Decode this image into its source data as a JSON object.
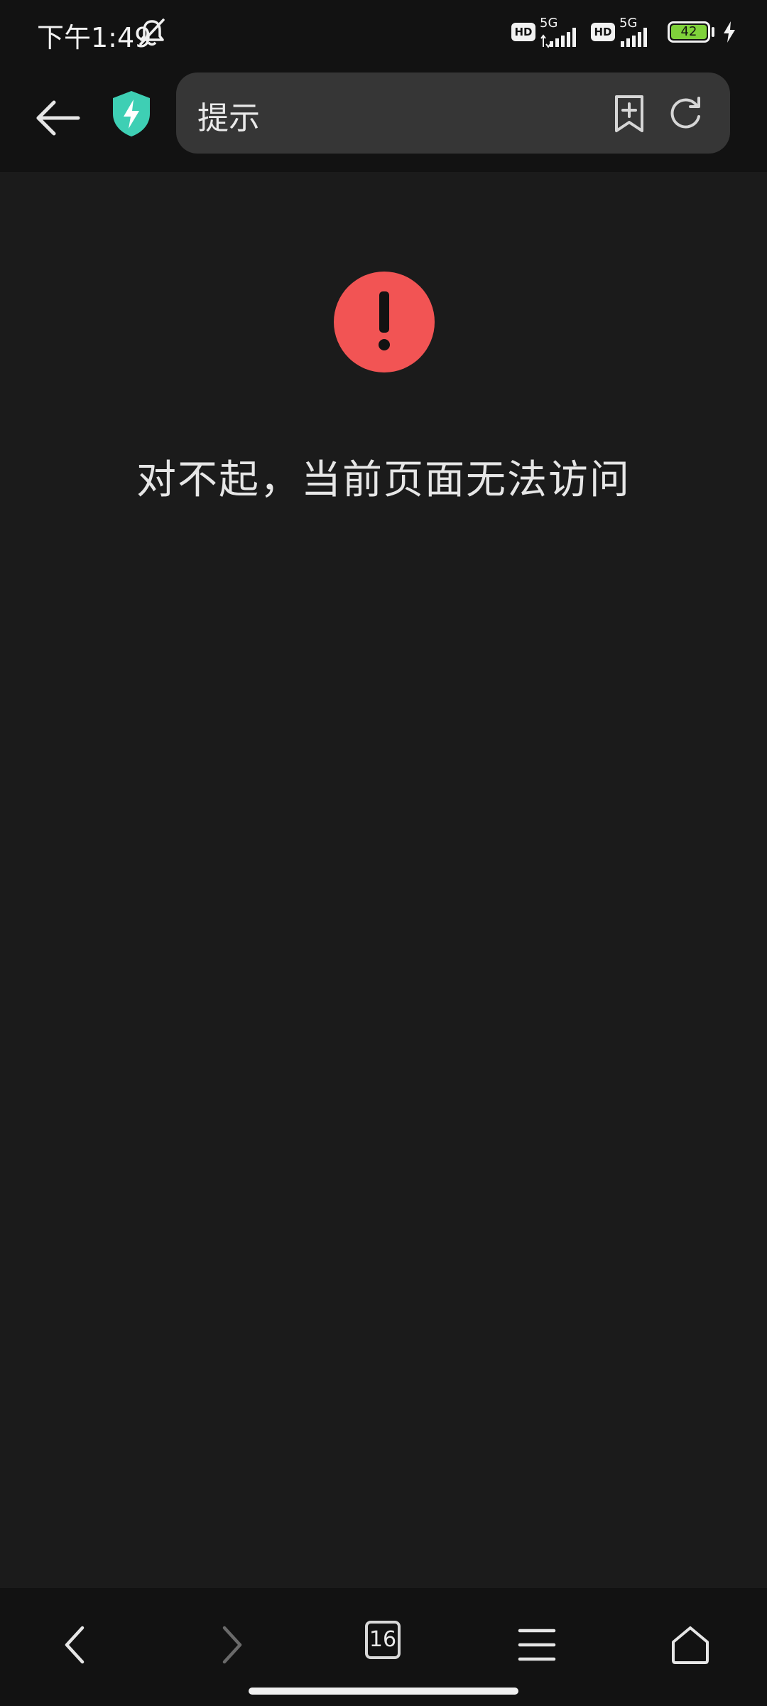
{
  "status_bar": {
    "time": "下午1:49",
    "sim1_network": "5G",
    "sim2_network": "5G",
    "hd_label": "HD",
    "battery_level": "42",
    "icons": [
      "bell-off-icon",
      "hd-icon",
      "signal-icon",
      "battery-icon",
      "charging-icon"
    ]
  },
  "top_bar": {
    "url_text": "提示",
    "icons": [
      "back-arrow-icon",
      "shield-icon",
      "bookmark-add-icon",
      "reload-icon"
    ]
  },
  "error_page": {
    "icon": "exclamation-icon",
    "message": "对不起，当前页面无法访问",
    "accent_color": "#f25454"
  },
  "bottom_nav": {
    "tab_count": "16",
    "icons": [
      "back-icon",
      "forward-icon",
      "tabs-icon",
      "menu-icon",
      "home-icon"
    ]
  },
  "colors": {
    "background": "#1b1b1b",
    "bar_background": "#121212",
    "url_box": "#363636",
    "shield": "#3ecfb4",
    "battery": "#7fd13b"
  }
}
